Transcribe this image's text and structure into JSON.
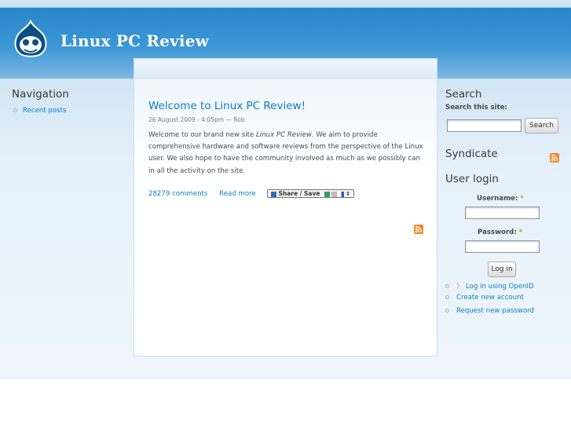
{
  "site": {
    "name": "Linux PC Review"
  },
  "node": {
    "title": "Welcome to Linux PC Review!",
    "meta": "26 August 2009 - 4:05pm — Rob",
    "body_pre": "Welcome to our brand new site ",
    "body_em": "Linux PC Review",
    "body_post": ". We aim to provide comprehensive hardware and software reviews from the perspective of the Linux user. We also hope to have the community involved as much as we possibly can in all the activity on the site.",
    "comments_link": "28279 comments",
    "read_more_link": "Read more",
    "share_label": "Share / Save"
  },
  "navigation": {
    "title": "Navigation",
    "items": [
      {
        "label": "Recent posts"
      }
    ]
  },
  "search": {
    "title": "Search",
    "label": "Search this site:",
    "value": "",
    "button_label": "Search"
  },
  "syndicate": {
    "title": "Syndicate"
  },
  "user_login": {
    "title": "User login",
    "username_label": "Username:",
    "password_label": "Password:",
    "required_marker": "*",
    "login_button": "Log in",
    "links": [
      {
        "label": "Log in using OpenID",
        "icon": "openid-icon"
      },
      {
        "label": "Create new account"
      },
      {
        "label": "Request new password"
      }
    ]
  },
  "colors": {
    "link": "#0b7fc1",
    "header": "#2a86c8",
    "feed": "#f08a24"
  }
}
